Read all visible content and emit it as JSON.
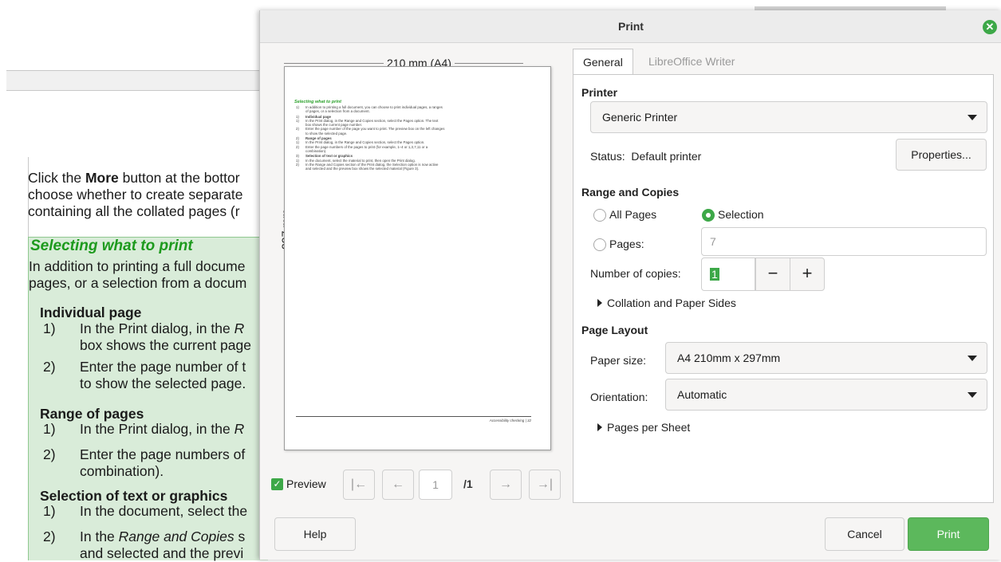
{
  "background": {
    "paragraph_lines": [
      {
        "pre": "Click the ",
        "bold": "More",
        "post": " button at the bottor"
      },
      {
        "pre": "choose whether to create separate",
        "bold": "",
        "post": ""
      },
      {
        "pre": "containing all the collated pages (r",
        "bold": "",
        "post": ""
      }
    ],
    "section_heading": "Selecting what to print",
    "intro_lines": [
      "In addition to printing a full docume",
      "pages, or a selection from a docum"
    ],
    "subheadings": [
      "Individual page",
      "Range of pages",
      "Selection of text or graphics"
    ],
    "items": [
      {
        "num": "1)",
        "text": "In the Print dialog, in the ",
        "ital": "R",
        "cont": "box shows the current page"
      },
      {
        "num": "2)",
        "text": "Enter the page number of t",
        "ital": "",
        "cont": "to show the selected page."
      },
      {
        "num": "1)",
        "text": "In the Print dialog, in the ",
        "ital": "R",
        "cont": ""
      },
      {
        "num": "2)",
        "text": "Enter the page numbers of",
        "ital": "",
        "cont": "combination)."
      },
      {
        "num": "1)",
        "text": "In the document, select the",
        "ital": "",
        "cont": ""
      },
      {
        "num": "2)",
        "text": "In the ",
        "ital": "Range and Copies",
        "post": " s",
        "cont": "and selected and the previ"
      }
    ]
  },
  "dialog": {
    "title": "Print",
    "close_icon": "close-icon",
    "preview": {
      "width_label": "210 mm (A4)",
      "height_label": "297 mm",
      "thumb_heading": "Selecting what to print",
      "thumb_footer": "Accessibility checking | 32",
      "thumb_lines": [
        {
          "n": "1)",
          "t": "In addition to printing a full document, you can choose to print individual pages, a ranges",
          "b": false
        },
        {
          "n": "",
          "t": "of pages, or a selection from a document.",
          "b": false
        },
        {
          "n": "1)",
          "t": "Individual page",
          "b": true
        },
        {
          "n": "1)",
          "t": "In the Print dialog, in the Range and Copies section, select the Pages option. The text",
          "b": false
        },
        {
          "n": "",
          "t": "box shows the current page number.",
          "b": false
        },
        {
          "n": "2)",
          "t": "Enter the page number of the page you want to print. The preview box on the left changes",
          "b": false
        },
        {
          "n": "",
          "t": "to show the selected page.",
          "b": false
        },
        {
          "n": "2)",
          "t": "Range of pages",
          "b": true
        },
        {
          "n": "1)",
          "t": "In the Print dialog, in the Range and Copies section, select the Pages option.",
          "b": false
        },
        {
          "n": "2)",
          "t": "Enter the page numbers of the pages to print (for example, 1–4 or 1,3,7,11 or a",
          "b": false
        },
        {
          "n": "",
          "t": "combination).",
          "b": false
        },
        {
          "n": "3)",
          "t": "Selection of text or graphics",
          "b": true
        },
        {
          "n": "1)",
          "t": "In the document, select the material to print, then open the Print dialog.",
          "b": false
        },
        {
          "n": "2)",
          "t": "In the Range and Copies section of the Print dialog, the Selection option is now active",
          "b": false
        },
        {
          "n": "",
          "t": "and selected and the preview box shows the selected material (Figure 3).",
          "b": false
        }
      ],
      "checkbox_label": "Preview",
      "page_value": "1",
      "page_total": "/1",
      "nav": {
        "first": "|←",
        "prev": "←",
        "next": "→",
        "last": "→|"
      }
    },
    "tabs": [
      "General",
      "LibreOffice Writer"
    ],
    "printer": {
      "section": "Printer",
      "selected": "Generic Printer",
      "status_label": "Status:",
      "status_value": "Default printer",
      "properties_button": "Properties..."
    },
    "range": {
      "section": "Range and Copies",
      "all_pages": "All Pages",
      "selection": "Selection",
      "pages": "Pages:",
      "pages_placeholder": "7",
      "copies_label": "Number of copies:",
      "copies_value": "1",
      "minus": "−",
      "plus": "+",
      "collation": "Collation and Paper Sides"
    },
    "layout": {
      "section": "Page Layout",
      "paper_label": "Paper size:",
      "paper_value": "A4 210mm x 297mm",
      "orientation_label": "Orientation:",
      "orientation_value": "Automatic",
      "pages_per_sheet": "Pages per Sheet"
    },
    "buttons": {
      "help": "Help",
      "cancel": "Cancel",
      "print": "Print"
    },
    "colors": {
      "accent": "#3da848",
      "print_button": "#5cb85c"
    }
  }
}
